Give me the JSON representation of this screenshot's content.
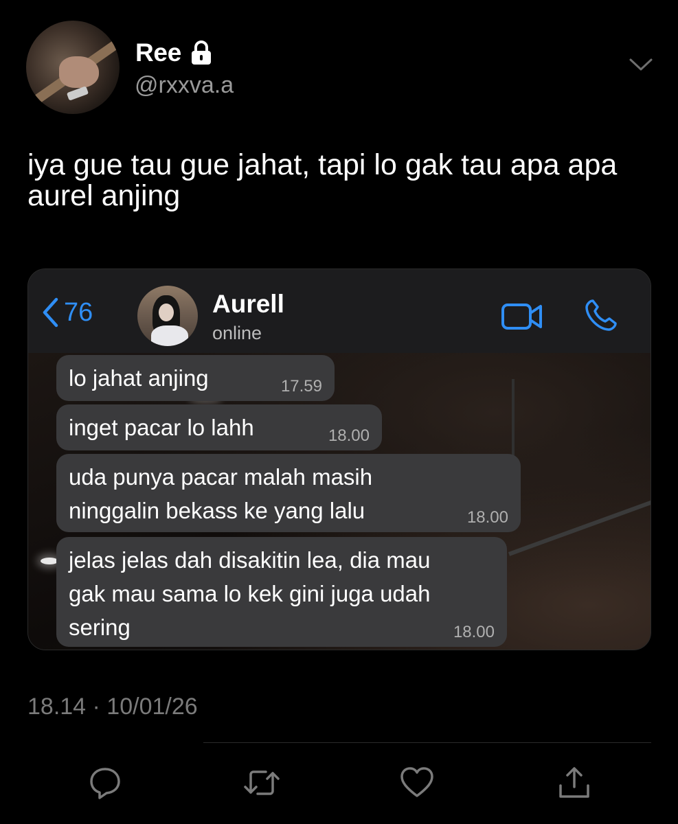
{
  "tweet": {
    "author_name": "Ree",
    "handle": "@rxxva.a",
    "text": "iya gue tau gue jahat, tapi lo gak tau apa apa aurel anjing",
    "timestamp": "18.14 · 10/01/26",
    "protected_icon": "lock-icon",
    "menu_icon": "chevron-down-icon"
  },
  "chat": {
    "back_count": "76",
    "contact_name": "Aurell",
    "contact_status": "online",
    "accent_color": "#2f8ef5",
    "messages": [
      {
        "text": "lo jahat anjing",
        "time": "17.59"
      },
      {
        "text": "inget pacar lo lahh",
        "time": "18.00"
      },
      {
        "text": "uda punya pacar malah masih\nninggalin bekass ke yang lalu",
        "time": "18.00"
      },
      {
        "text": "jelas jelas dah disakitin lea, dia mau\ngak mau sama lo kek gini juga udah\nsering",
        "time": "18.00"
      }
    ]
  },
  "actions": [
    {
      "icon": "reply-icon"
    },
    {
      "icon": "retweet-icon"
    },
    {
      "icon": "like-icon"
    },
    {
      "icon": "share-icon"
    }
  ]
}
